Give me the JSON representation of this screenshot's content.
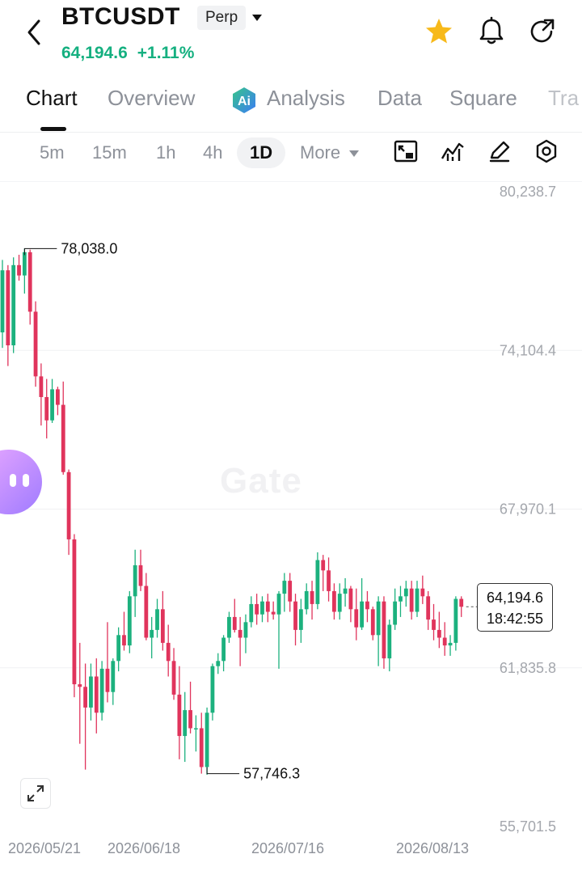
{
  "header": {
    "symbol": "BTCUSDT",
    "contract_type": "Perp",
    "last_price": "64,194.6",
    "change_pct": "+1.11%",
    "icons": [
      "back-arrow-icon",
      "dropdown-caret-icon",
      "star-icon",
      "bell-icon",
      "refresh-share-icon"
    ]
  },
  "tabs": [
    {
      "label": "Chart",
      "active": true
    },
    {
      "label": "Overview"
    },
    {
      "label": "Analysis"
    },
    {
      "label": "Data"
    },
    {
      "label": "Square"
    },
    {
      "label": "Tra"
    }
  ],
  "intervals": {
    "items": [
      "5m",
      "15m",
      "1h",
      "4h",
      "1D"
    ],
    "selected": "1D",
    "more_label": "More"
  },
  "tools": [
    "indicator-icon",
    "chart-style-icon",
    "draw-icon",
    "settings-icon"
  ],
  "watermark": "Gate",
  "colors": {
    "up": "#1cb17e",
    "down": "#e0345c",
    "accent": "#15b080"
  },
  "chart_data": {
    "type": "candlestick",
    "y_ticks": [
      "80,238.7",
      "74,104.4",
      "67,970.1",
      "61,835.8",
      "55,701.5"
    ],
    "x_ticks": [
      "2026/05/21",
      "2026/06/18",
      "2026/07/16",
      "2026/08/13"
    ],
    "high_marker": "78,038.0",
    "low_marker": "57,746.3",
    "current_price": "64,194.6",
    "countdown": "18:42:55",
    "candles": [
      [
        74800,
        77600,
        74200,
        77200
      ],
      [
        77200,
        77400,
        73500,
        74300
      ],
      [
        74300,
        77700,
        74000,
        77400
      ],
      [
        77400,
        77800,
        76800,
        77000
      ],
      [
        77000,
        78038,
        76300,
        77900
      ],
      [
        77900,
        78000,
        75100,
        75600
      ],
      [
        75600,
        76000,
        72700,
        73100
      ],
      [
        73100,
        73600,
        71200,
        72300
      ],
      [
        72300,
        73000,
        70700,
        71400
      ],
      [
        71400,
        73000,
        71300,
        72600
      ],
      [
        72600,
        72700,
        71600,
        72000
      ],
      [
        72000,
        72900,
        69300,
        69400
      ],
      [
        69400,
        69500,
        66200,
        66800
      ],
      [
        66800,
        67000,
        60700,
        61200
      ],
      [
        61200,
        62800,
        58900,
        61100
      ],
      [
        61100,
        62000,
        57900,
        60300
      ],
      [
        60300,
        62000,
        59800,
        61500
      ],
      [
        61500,
        62200,
        59300,
        60100
      ],
      [
        60100,
        62100,
        59800,
        61800
      ],
      [
        61800,
        63600,
        60500,
        60900
      ],
      [
        60900,
        62200,
        60400,
        62100
      ],
      [
        62100,
        63400,
        61700,
        63100
      ],
      [
        63100,
        64000,
        62500,
        62700
      ],
      [
        62700,
        64800,
        62400,
        64600
      ],
      [
        64600,
        66400,
        63800,
        65800
      ],
      [
        65800,
        66400,
        64800,
        65000
      ],
      [
        65000,
        65500,
        62900,
        63000
      ],
      [
        63000,
        63800,
        62200,
        63300
      ],
      [
        63300,
        64500,
        63000,
        64100
      ],
      [
        64100,
        64800,
        62500,
        62800
      ],
      [
        62800,
        63500,
        61500,
        62100
      ],
      [
        62100,
        62600,
        60600,
        60800
      ],
      [
        60800,
        61900,
        58300,
        59200
      ],
      [
        59200,
        60900,
        58200,
        60200
      ],
      [
        60200,
        61300,
        59300,
        59500
      ],
      [
        59500,
        60000,
        58600,
        59500
      ],
      [
        59500,
        60100,
        57746,
        58000
      ],
      [
        58000,
        60300,
        57700,
        60100
      ],
      [
        60100,
        62000,
        59800,
        61900
      ],
      [
        61900,
        62400,
        61600,
        62100
      ],
      [
        62100,
        63100,
        61700,
        63000
      ],
      [
        63000,
        64000,
        62800,
        63800
      ],
      [
        63800,
        64500,
        63200,
        63300
      ],
      [
        63300,
        63800,
        61900,
        63000
      ],
      [
        63000,
        63900,
        62400,
        63600
      ],
      [
        63600,
        64600,
        63400,
        64300
      ],
      [
        64300,
        64700,
        63500,
        63900
      ],
      [
        63900,
        64600,
        63600,
        64400
      ],
      [
        64400,
        64700,
        63600,
        64000
      ],
      [
        64000,
        64400,
        63700,
        63900
      ],
      [
        63900,
        64800,
        61800,
        64700
      ],
      [
        64700,
        65500,
        64000,
        65200
      ],
      [
        65200,
        65500,
        64000,
        64400
      ],
      [
        64400,
        64700,
        62700,
        63300
      ],
      [
        63300,
        64500,
        62800,
        64100
      ],
      [
        64100,
        65100,
        63900,
        64800
      ],
      [
        64800,
        65200,
        63700,
        64300
      ],
      [
        64300,
        66300,
        64100,
        66000
      ],
      [
        66000,
        66200,
        64800,
        65600
      ],
      [
        65600,
        66100,
        64400,
        64800
      ],
      [
        64800,
        65100,
        63700,
        64000
      ],
      [
        64000,
        65100,
        63700,
        64700
      ],
      [
        64700,
        65300,
        64200,
        64900
      ],
      [
        64900,
        65000,
        63600,
        64100
      ],
      [
        64100,
        64900,
        62900,
        63400
      ],
      [
        63400,
        65300,
        63300,
        64400
      ],
      [
        64400,
        64800,
        63600,
        64100
      ],
      [
        64100,
        64200,
        62900,
        63100
      ],
      [
        63100,
        64600,
        61900,
        64400
      ],
      [
        64400,
        64600,
        61800,
        62200
      ],
      [
        62200,
        63700,
        61700,
        63500
      ],
      [
        63500,
        64900,
        63300,
        64400
      ],
      [
        64400,
        65000,
        63800,
        64600
      ],
      [
        64600,
        65200,
        64200,
        64900
      ],
      [
        64900,
        65200,
        63700,
        64000
      ],
      [
        64000,
        65200,
        63800,
        64900
      ],
      [
        64900,
        65400,
        64300,
        64600
      ],
      [
        64600,
        64800,
        63300,
        63700
      ],
      [
        63700,
        64300,
        62900,
        63300
      ],
      [
        63300,
        64000,
        62600,
        63000
      ],
      [
        63000,
        63600,
        62300,
        62700
      ],
      [
        62700,
        63100,
        62300,
        62800
      ],
      [
        62800,
        64600,
        62500,
        64500
      ],
      [
        64500,
        64600,
        63800,
        64195
      ]
    ]
  }
}
